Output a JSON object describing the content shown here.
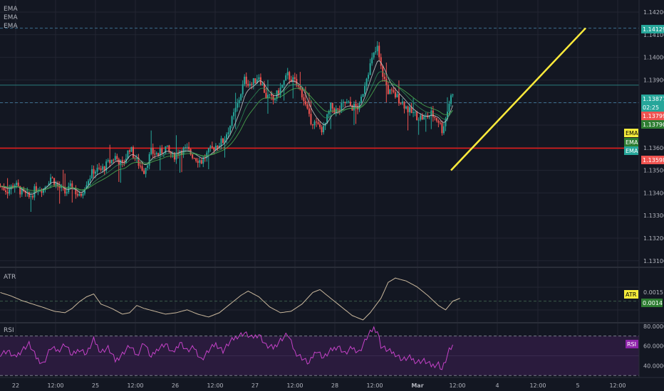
{
  "colors": {
    "background": "#131722",
    "grid": "#232632",
    "axis_text": "#b2b5be",
    "up": "#26a69a",
    "down": "#ef5350",
    "ema_fast": "#c8c8c8",
    "ema_mid": "#2e8b57",
    "ema_slow": "#4caf50",
    "support": "#e01b1b",
    "trend_line": "#ffeb3b",
    "atr_line": "#c9b79c",
    "rsi_line": "#c542c8",
    "rsi_band": "#2a1b3d",
    "label_yellow": "#f5eb3b",
    "label_green": "#2e7d32",
    "label_teal": "#26a69a",
    "label_red": "#ef5350"
  },
  "legend": {
    "ema1": "EMA",
    "ema2": "EMA",
    "ema3": "EMA"
  },
  "chart_data": [
    {
      "type": "candlestick",
      "y_ticks": [
        "1.14200",
        "1.14100",
        "1.14000",
        "1.13900",
        "1.13800",
        "1.13700",
        "1.13600",
        "1.13500",
        "1.13400",
        "1.13300",
        "1.13200",
        "1.13100"
      ],
      "x_ticks": [
        "22",
        "12:00",
        "25",
        "12:00",
        "26",
        "12:00",
        "27",
        "12:00",
        "28",
        "12:00",
        "Mar",
        "12:00",
        "4",
        "12:00",
        "5",
        "12:00"
      ],
      "ylim": [
        1.131,
        1.1425
      ],
      "anchors": [
        [
          0,
          1.1343
        ],
        [
          4,
          1.1341
        ],
        [
          8,
          1.1344
        ],
        [
          12,
          1.134
        ],
        [
          16,
          1.1338
        ],
        [
          20,
          1.1342
        ],
        [
          24,
          1.1342
        ],
        [
          28,
          1.1347
        ],
        [
          32,
          1.1343
        ],
        [
          36,
          1.134
        ],
        [
          40,
          1.1343
        ],
        [
          44,
          1.1338
        ],
        [
          48,
          1.1345
        ],
        [
          52,
          1.135
        ],
        [
          56,
          1.135
        ],
        [
          60,
          1.1353
        ],
        [
          64,
          1.1356
        ],
        [
          68,
          1.1352
        ],
        [
          72,
          1.136
        ],
        [
          76,
          1.1354
        ],
        [
          80,
          1.135
        ],
        [
          84,
          1.1358
        ],
        [
          88,
          1.1357
        ],
        [
          92,
          1.136
        ],
        [
          96,
          1.1356
        ],
        [
          100,
          1.1359
        ],
        [
          104,
          1.1359
        ],
        [
          108,
          1.1356
        ],
        [
          112,
          1.1354
        ],
        [
          116,
          1.1358
        ],
        [
          120,
          1.1361
        ],
        [
          124,
          1.1363
        ],
        [
          128,
          1.137
        ],
        [
          132,
          1.1379
        ],
        [
          136,
          1.139
        ],
        [
          140,
          1.1388
        ],
        [
          144,
          1.1392
        ],
        [
          148,
          1.1383
        ],
        [
          152,
          1.1381
        ],
        [
          156,
          1.1386
        ],
        [
          160,
          1.1392
        ],
        [
          164,
          1.1389
        ],
        [
          168,
          1.1384
        ],
        [
          172,
          1.1373
        ],
        [
          176,
          1.137
        ],
        [
          180,
          1.1368
        ],
        [
          184,
          1.1378
        ],
        [
          188,
          1.1376
        ],
        [
          192,
          1.138
        ],
        [
          196,
          1.1378
        ],
        [
          200,
          1.1378
        ],
        [
          204,
          1.1392
        ],
        [
          208,
          1.1401
        ],
        [
          210,
          1.1404
        ],
        [
          212,
          1.1395
        ],
        [
          216,
          1.1385
        ],
        [
          220,
          1.1383
        ],
        [
          224,
          1.138
        ],
        [
          228,
          1.1376
        ],
        [
          232,
          1.1374
        ],
        [
          236,
          1.1373
        ],
        [
          240,
          1.1375
        ],
        [
          244,
          1.1372
        ],
        [
          246,
          1.1368
        ],
        [
          248,
          1.1373
        ],
        [
          250,
          1.138
        ],
        [
          252,
          1.1385
        ]
      ],
      "series": [
        {
          "name": "EMA",
          "role": "fast"
        },
        {
          "name": "EMA",
          "role": "mid"
        },
        {
          "name": "EMA",
          "role": "slow"
        }
      ],
      "horizontal_lines": [
        {
          "value": 1.14129,
          "style": "dashed"
        },
        {
          "value": 1.13877,
          "style": "solid"
        },
        {
          "value": 1.13799,
          "style": "dashed"
        },
        {
          "value": 1.13598,
          "style": "solid",
          "role": "support"
        }
      ],
      "trend_line": {
        "from_candle": 251,
        "from_y": 1.135,
        "to_candle": 326,
        "to_y": 1.14129
      },
      "price_labels": [
        {
          "text": "1.14129",
          "color": "teal"
        },
        {
          "text": "1.13877",
          "color": "teal"
        },
        {
          "text": "02:25",
          "color": "teal"
        },
        {
          "text": "1.13799",
          "color": "red"
        },
        {
          "text": "1.13790",
          "color": "green"
        },
        {
          "text": "1.13598",
          "color": "red"
        }
      ],
      "ema_tags": [
        "EMA",
        "EMA",
        "EMA"
      ]
    },
    {
      "type": "line",
      "title": "ATR",
      "y_ticks": [
        "0.0015"
      ],
      "ylim": [
        0.00075,
        0.00245
      ],
      "values": [
        [
          0,
          0.0017
        ],
        [
          6,
          0.00158
        ],
        [
          12,
          0.00142
        ],
        [
          18,
          0.0013
        ],
        [
          24,
          0.00118
        ],
        [
          30,
          0.00105
        ],
        [
          36,
          0.001
        ],
        [
          40,
          0.00115
        ],
        [
          44,
          0.00138
        ],
        [
          48,
          0.00155
        ],
        [
          52,
          0.00165
        ],
        [
          56,
          0.0013
        ],
        [
          62,
          0.00115
        ],
        [
          68,
          0.00095
        ],
        [
          72,
          0.001
        ],
        [
          76,
          0.00125
        ],
        [
          80,
          0.00115
        ],
        [
          86,
          0.00105
        ],
        [
          92,
          0.00095
        ],
        [
          98,
          0.001
        ],
        [
          104,
          0.0011
        ],
        [
          110,
          0.00095
        ],
        [
          116,
          0.00085
        ],
        [
          122,
          0.001
        ],
        [
          128,
          0.0013
        ],
        [
          134,
          0.0016
        ],
        [
          138,
          0.00175
        ],
        [
          144,
          0.00155
        ],
        [
          150,
          0.0012
        ],
        [
          156,
          0.001
        ],
        [
          162,
          0.00105
        ],
        [
          168,
          0.0013
        ],
        [
          174,
          0.0017
        ],
        [
          178,
          0.0018
        ],
        [
          184,
          0.0015
        ],
        [
          190,
          0.0012
        ],
        [
          196,
          0.0009
        ],
        [
          202,
          0.00075
        ],
        [
          206,
          0.001
        ],
        [
          212,
          0.0015
        ],
        [
          216,
          0.00205
        ],
        [
          220,
          0.0022
        ],
        [
          226,
          0.0021
        ],
        [
          232,
          0.0019
        ],
        [
          238,
          0.0016
        ],
        [
          244,
          0.00125
        ],
        [
          248,
          0.0011
        ],
        [
          252,
          0.0014
        ],
        [
          256,
          0.0015
        ]
      ],
      "current_label": "ATR",
      "current_value": "0.0014",
      "reference_line": 0.0014
    },
    {
      "type": "line",
      "title": "RSI",
      "y_ticks": [
        "80.0000",
        "60.0000",
        "40.0000"
      ],
      "ylim": [
        28,
        82
      ],
      "band": [
        30,
        70
      ],
      "values": [
        [
          0,
          52
        ],
        [
          4,
          55
        ],
        [
          8,
          48
        ],
        [
          12,
          56
        ],
        [
          16,
          62
        ],
        [
          20,
          48
        ],
        [
          24,
          42
        ],
        [
          28,
          58
        ],
        [
          32,
          55
        ],
        [
          36,
          62
        ],
        [
          40,
          50
        ],
        [
          44,
          57
        ],
        [
          48,
          52
        ],
        [
          52,
          66
        ],
        [
          56,
          54
        ],
        [
          60,
          58
        ],
        [
          64,
          45
        ],
        [
          68,
          52
        ],
        [
          72,
          60
        ],
        [
          76,
          50
        ],
        [
          80,
          64
        ],
        [
          84,
          48
        ],
        [
          88,
          58
        ],
        [
          92,
          62
        ],
        [
          96,
          52
        ],
        [
          100,
          64
        ],
        [
          104,
          55
        ],
        [
          108,
          58
        ],
        [
          112,
          46
        ],
        [
          116,
          55
        ],
        [
          120,
          62
        ],
        [
          124,
          55
        ],
        [
          128,
          64
        ],
        [
          132,
          70
        ],
        [
          136,
          73
        ],
        [
          140,
          68
        ],
        [
          144,
          72
        ],
        [
          148,
          60
        ],
        [
          152,
          58
        ],
        [
          156,
          66
        ],
        [
          160,
          72
        ],
        [
          164,
          54
        ],
        [
          168,
          48
        ],
        [
          172,
          42
        ],
        [
          176,
          56
        ],
        [
          180,
          48
        ],
        [
          184,
          55
        ],
        [
          188,
          60
        ],
        [
          192,
          52
        ],
        [
          196,
          58
        ],
        [
          200,
          54
        ],
        [
          204,
          68
        ],
        [
          208,
          78
        ],
        [
          210,
          75
        ],
        [
          212,
          60
        ],
        [
          216,
          55
        ],
        [
          220,
          52
        ],
        [
          224,
          46
        ],
        [
          228,
          48
        ],
        [
          232,
          44
        ],
        [
          236,
          45
        ],
        [
          240,
          40
        ],
        [
          244,
          42
        ],
        [
          246,
          36
        ],
        [
          248,
          45
        ],
        [
          250,
          55
        ],
        [
          252,
          60
        ]
      ],
      "current_label": "RSI"
    }
  ]
}
